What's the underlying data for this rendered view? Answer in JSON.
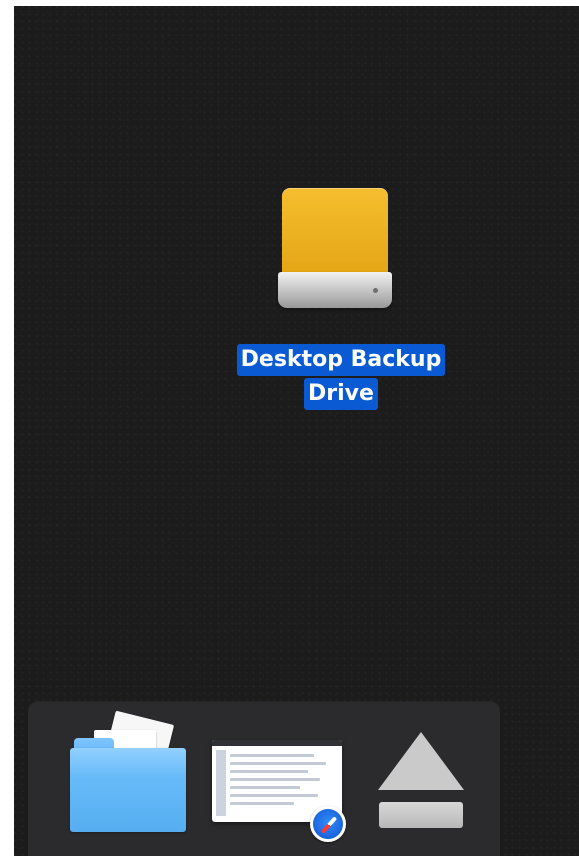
{
  "desktop": {
    "items": [
      {
        "type": "drive",
        "label_lines": [
          "Desktop Backup",
          "Drive"
        ],
        "icon": "external-drive-icon",
        "selected": true,
        "accent": "#0a5bd3"
      }
    ]
  },
  "dock": {
    "items": [
      {
        "name": "Finder",
        "icon": "folder-icon"
      },
      {
        "name": "Safari window preview",
        "icon": "safari-window-icon"
      },
      {
        "name": "Eject",
        "icon": "eject-icon"
      }
    ]
  },
  "colors": {
    "desktop_bg": "#1c1c1d",
    "dock_bg": "#2b2b2d",
    "drive_gold": "#e4a514",
    "selection_blue": "#0a5bd3"
  }
}
